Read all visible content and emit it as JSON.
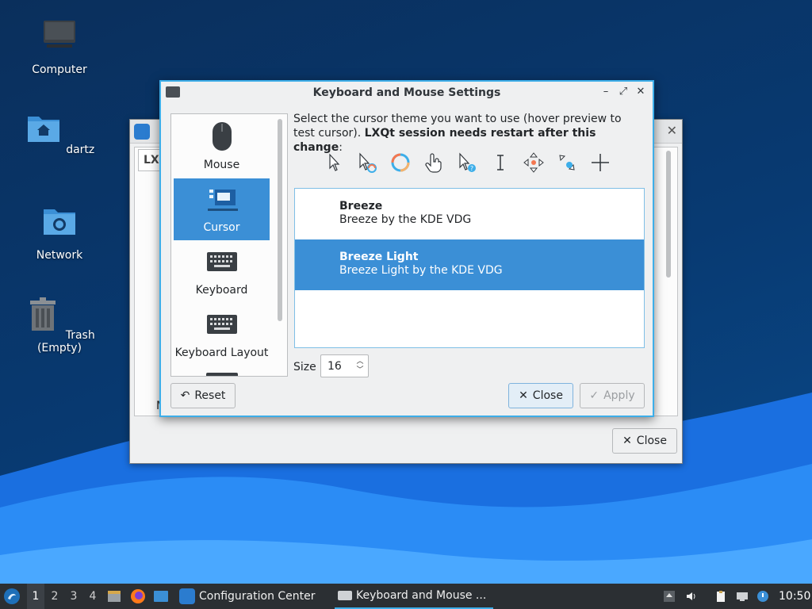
{
  "desktop": {
    "icons": [
      {
        "label": "Computer",
        "icon": "computer-icon"
      },
      {
        "label": "dartz",
        "icon": "home-folder-icon"
      },
      {
        "label": "Network",
        "icon": "network-folder-icon"
      },
      {
        "label": "Trash (Empty)",
        "icon": "trash-icon"
      }
    ]
  },
  "back_window": {
    "tab_label": "LXQ",
    "partial_text": "M",
    "close_button": "Close"
  },
  "dialog": {
    "title": "Keyboard and Mouse Settings",
    "sidebar": [
      {
        "label": "Mouse",
        "icon": "mouse-icon",
        "selected": false
      },
      {
        "label": "Cursor",
        "icon": "cursor-settings-icon",
        "selected": true
      },
      {
        "label": "Keyboard",
        "icon": "keyboard-icon",
        "selected": false
      },
      {
        "label": "Keyboard Layout",
        "icon": "keyboard-layout-icon",
        "selected": false
      }
    ],
    "instructions_plain": "Select the cursor theme you want to use (hover preview to test cursor). ",
    "instructions_bold": "LXQt session needs restart after this change",
    "instructions_end": ":",
    "cursor_previews": [
      "arrow-cursor-icon",
      "busy-arrow-cursor-icon",
      "wait-cursor-icon",
      "hand-cursor-icon",
      "help-cursor-icon",
      "text-cursor-icon",
      "move-cursor-icon",
      "resize-cursor-icon",
      "crosshair-cursor-icon"
    ],
    "themes": [
      {
        "name": "Breeze",
        "description": "Breeze by the KDE VDG",
        "selected": false
      },
      {
        "name": "Breeze Light",
        "description": "Breeze Light by the KDE VDG",
        "selected": true
      }
    ],
    "size_label": "Size",
    "size_value": "16",
    "reset_button": "Reset",
    "close_button": "Close",
    "apply_button": "Apply",
    "accent_color": "#3daee9",
    "selection_color": "#3b8fd6"
  },
  "taskbar": {
    "workspaces": [
      "1",
      "2",
      "3",
      "4"
    ],
    "active_workspace": "1",
    "tasks": [
      {
        "label": "Configuration Center",
        "icon": "config-center-icon",
        "active": false
      },
      {
        "label": "Keyboard and Mouse ...",
        "icon": "keyboard-icon",
        "active": true
      }
    ],
    "clock": "10:50"
  }
}
